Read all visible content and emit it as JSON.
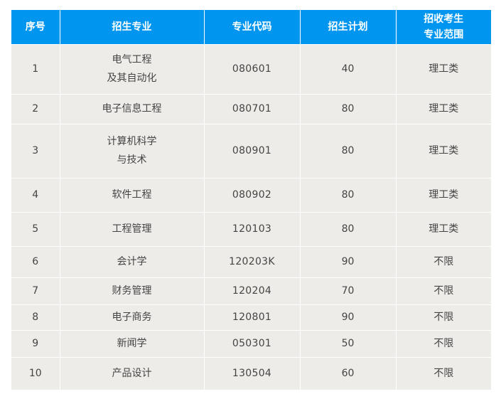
{
  "table": {
    "headers": {
      "index": "序号",
      "major": "招生专业",
      "code": "专业代码",
      "plan": "招生计划",
      "range_line1": "招收考生",
      "range_line2": "专业范围"
    },
    "rows": [
      {
        "index": "1",
        "major_line1": "电气工程",
        "major_line2": "及其自动化",
        "code": "080601",
        "plan": "40",
        "range": "理工类"
      },
      {
        "index": "2",
        "major_line1": "电子信息工程",
        "major_line2": "",
        "code": "080701",
        "plan": "80",
        "range": "理工类"
      },
      {
        "index": "3",
        "major_line1": "计算机科学",
        "major_line2": "与技术",
        "code": "080901",
        "plan": "80",
        "range": "理工类"
      },
      {
        "index": "4",
        "major_line1": "软件工程",
        "major_line2": "",
        "code": "080902",
        "plan": "80",
        "range": "理工类"
      },
      {
        "index": "5",
        "major_line1": "工程管理",
        "major_line2": "",
        "code": "120103",
        "plan": "80",
        "range": "理工类"
      },
      {
        "index": "6",
        "major_line1": "会计学",
        "major_line2": "",
        "code": "120203K",
        "plan": "90",
        "range": "不限"
      },
      {
        "index": "7",
        "major_line1": "财务管理",
        "major_line2": "",
        "code": "120204",
        "plan": "70",
        "range": "不限"
      },
      {
        "index": "8",
        "major_line1": "电子商务",
        "major_line2": "",
        "code": "120801",
        "plan": "90",
        "range": "不限"
      },
      {
        "index": "9",
        "major_line1": "新闻学",
        "major_line2": "",
        "code": "050301",
        "plan": "50",
        "range": "不限"
      },
      {
        "index": "10",
        "major_line1": "产品设计",
        "major_line2": "",
        "code": "130504",
        "plan": "60",
        "range": "不限"
      }
    ]
  },
  "colors": {
    "header_bg": "#0096f0",
    "header_text": "#ffffff",
    "cell_bg": "#eeece8",
    "cell_text": "#444444"
  }
}
